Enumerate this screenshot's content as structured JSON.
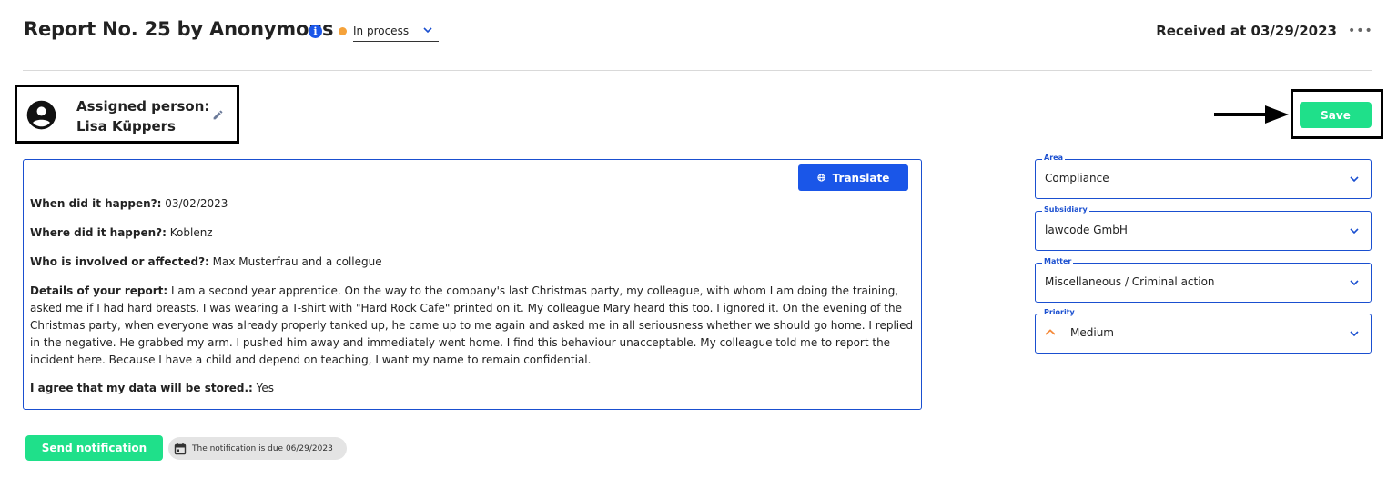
{
  "header": {
    "title": "Report No. 25 by Anonymous",
    "info_icon": "info-icon",
    "status": {
      "value": "In process",
      "dot_color": "#f5a23a"
    },
    "received": "Received at 03/29/2023",
    "more_icon": "more-horizontal-icon"
  },
  "assigned": {
    "label": "Assigned person:",
    "name": "Lisa Küppers",
    "avatar_icon": "account-circle-icon",
    "edit_icon": "pencil-icon"
  },
  "actions": {
    "save_label": "Save",
    "translate_label": "Translate",
    "send_notification_label": "Send notification",
    "due_text": "The notification is due 06/29/2023"
  },
  "report": {
    "fields": [
      {
        "label": "When did it happen?:",
        "value": "03/02/2023"
      },
      {
        "label": "Where did it happen?:",
        "value": "Koblenz"
      },
      {
        "label": "Who is involved or affected?:",
        "value": "Max Musterfrau and a collegue"
      },
      {
        "label": "Details of your report:",
        "value": "I am a second year apprentice. On the way to the company's last Christmas party, my colleague, with whom I am doing the training, asked me if I had hard breasts. I was wearing a T-shirt with \"Hard Rock Cafe\" printed on it. My colleague Mary heard this too. I ignored it. On the evening of the Christmas party, when everyone was already properly tanked up, he came up to me again and asked me in all seriousness whether we should go home. I replied in the negative. He grabbed my arm. I pushed him away and immediately went home. I find this behaviour unacceptable. My colleague told me to report the incident here. Because I have a child and depend on teaching, I want my name to remain confidential."
      },
      {
        "label": "I agree that my data will be stored.:",
        "value": "Yes"
      }
    ]
  },
  "sidebar": {
    "area": {
      "label": "Area",
      "value": "Compliance"
    },
    "subsidiary": {
      "label": "Subsidiary",
      "value": "lawcode GmbH"
    },
    "matter": {
      "label": "Matter",
      "value": "Miscellaneous / Criminal action"
    },
    "priority": {
      "label": "Priority",
      "value": "Medium",
      "icon_color": "#f58a3a"
    }
  },
  "colors": {
    "accent_blue": "#1a56e8",
    "accent_green": "#1fe08a"
  }
}
